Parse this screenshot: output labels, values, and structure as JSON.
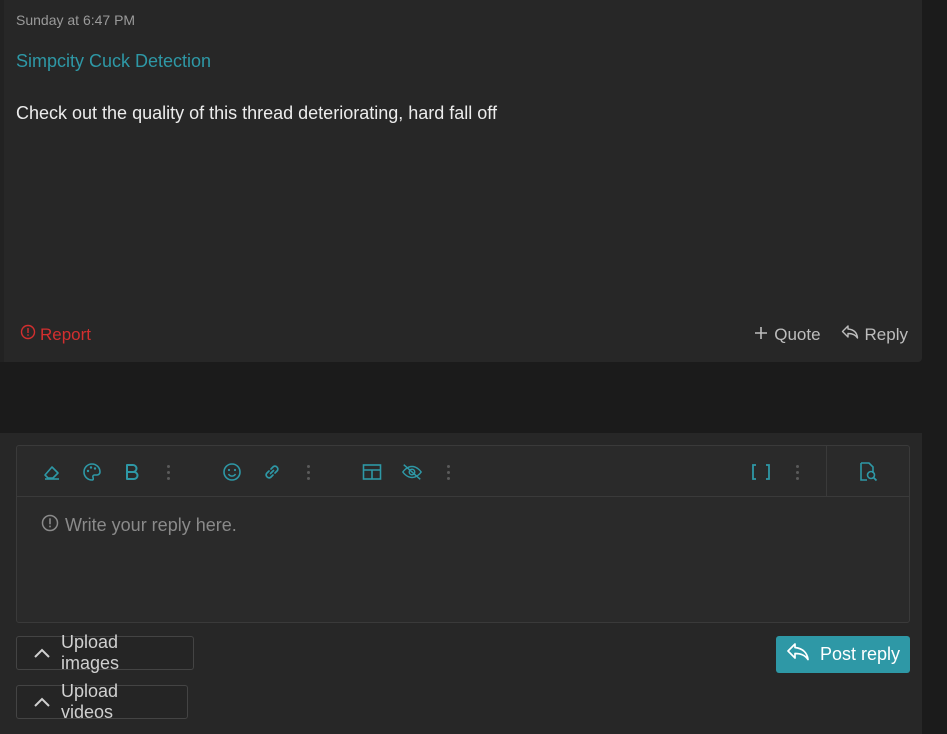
{
  "post": {
    "timestamp": "Sunday at 6:47 PM",
    "thread_link": "Simpcity Cuck Detection",
    "message": "Check out the quality of this thread deteriorating, hard fall off",
    "report_label": "Report",
    "quote_label": "Quote",
    "reply_label": "Reply"
  },
  "editor": {
    "placeholder": "Write your reply here.",
    "toolbar_icons": [
      "eraser-icon",
      "palette-icon",
      "bold-icon",
      "more-icon",
      "smiley-icon",
      "link-icon",
      "more-icon",
      "table-icon",
      "hide-icon",
      "more-icon",
      "brackets-icon",
      "more-icon",
      "preview-icon"
    ]
  },
  "uploads": {
    "images_label": "Upload images",
    "videos_label": "Upload videos"
  },
  "submit": {
    "post_reply_label": "Post reply"
  },
  "colors": {
    "accent": "#2e98a6",
    "report": "#d32f2f",
    "background": "#1b1b1b",
    "panel": "#272727"
  }
}
